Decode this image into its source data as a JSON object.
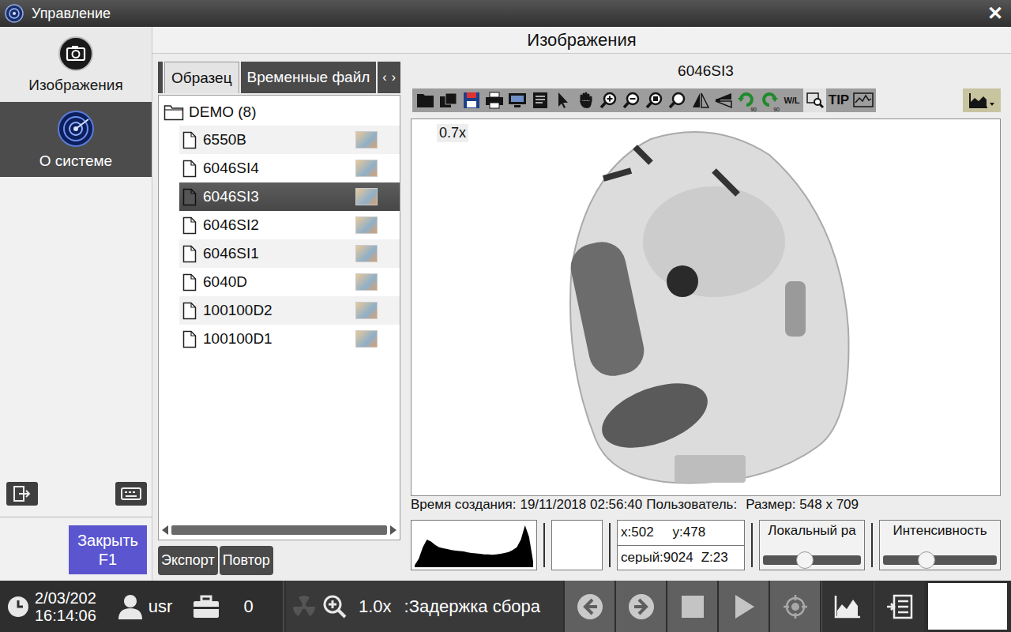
{
  "window": {
    "title": "Управление",
    "close": "✕"
  },
  "sidebar": {
    "items": [
      {
        "label": "Изображения",
        "selected": true
      },
      {
        "label": "О системе",
        "selected": false
      }
    ],
    "close_button": {
      "label": "Закрыть",
      "key": "F1"
    }
  },
  "header": "Изображения",
  "browser": {
    "tabs": [
      {
        "label": "Образец",
        "selected": true
      },
      {
        "label": "Временные файл",
        "selected": false
      }
    ],
    "tab_arrows": [
      "‹",
      "›"
    ],
    "folder": {
      "name": "DEMO (8)",
      "expanded": true
    },
    "files": [
      {
        "name": "6550B",
        "selected": false
      },
      {
        "name": "6046SI4",
        "selected": false
      },
      {
        "name": "6046SI3",
        "selected": true
      },
      {
        "name": "6046SI2",
        "selected": false
      },
      {
        "name": "6046SI1",
        "selected": false
      },
      {
        "name": "6040D",
        "selected": false
      },
      {
        "name": "100100D2",
        "selected": false
      },
      {
        "name": "100100D1",
        "selected": false
      }
    ],
    "buttons": [
      "Экспорт",
      "Повтор"
    ]
  },
  "viewer": {
    "title": "6046SI3",
    "zoom": "0.7x",
    "toolbar": {
      "rotate": "90",
      "wl": "W/L",
      "tip": "TIP"
    },
    "info": {
      "created_label": "Время создания:",
      "created": "19/11/2018 02:56:40",
      "user_label": "Пользователь:",
      "size_label": "Размер:",
      "size": "548 x 709"
    },
    "histogram": [
      4,
      18,
      42,
      58,
      54,
      47,
      42,
      40,
      38,
      36,
      35,
      34,
      33,
      31,
      30,
      29,
      28,
      27,
      27,
      26,
      27,
      28,
      30,
      32,
      36,
      42,
      58,
      88,
      64,
      12
    ],
    "readout": {
      "x": "x:502",
      "y": "y:478",
      "gray": "серый:9024",
      "z": "Z:23"
    },
    "sliders": [
      {
        "label": "Локальный ра",
        "level": 0.43
      },
      {
        "label": "Интенсивность",
        "level": 0.38
      }
    ]
  },
  "status_bar": {
    "date": "2/03/202",
    "time": "16:14:06",
    "user": "usr",
    "count": "0",
    "zoom": "1.0x",
    "delay": ":Задержка сбора"
  }
}
